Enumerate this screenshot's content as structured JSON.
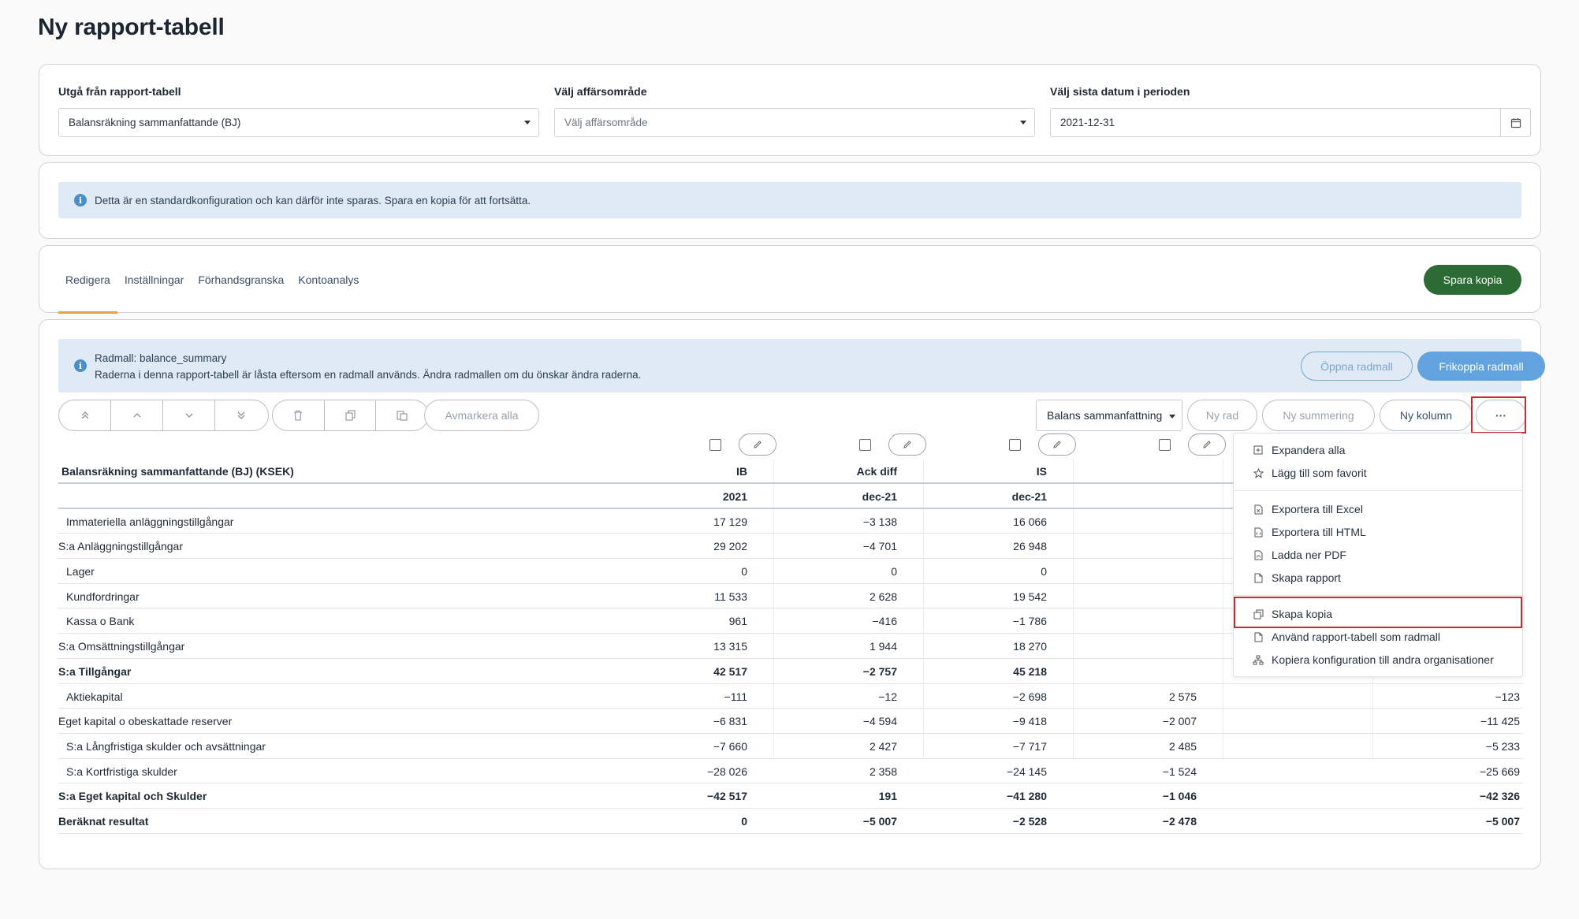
{
  "page": {
    "title": "Ny rapport-tabell"
  },
  "filters": {
    "report": {
      "label": "Utgå från rapport-tabell",
      "value": "Balansräkning sammanfattande (BJ)"
    },
    "area": {
      "label": "Välj affärsområde",
      "placeholder": "Välj affärsområde"
    },
    "date": {
      "label": "Välj sista datum i perioden",
      "value": "2021-12-31"
    }
  },
  "info": {
    "text": "Detta är en standardkonfiguration och kan därför inte sparas. Spara en kopia för att fortsätta."
  },
  "tabs": {
    "items": [
      {
        "label": "Redigera",
        "active": true
      },
      {
        "label": "Inställningar",
        "active": false
      },
      {
        "label": "Förhandsgranska",
        "active": false
      },
      {
        "label": "Kontoanalys",
        "active": false
      }
    ],
    "save_label": "Spara kopia"
  },
  "radmall": {
    "line1": "Radmall: balance_summary",
    "line2": "Raderna i denna rapport-tabell är låsta eftersom en radmall används. Ändra radmallen om du önskar ändra raderna.",
    "open_label": "Öppna radmall",
    "detach_label": "Frikoppla radmall"
  },
  "toolbar": {
    "deselect_label": "Avmarkera alla",
    "view_select": "Balans sammanfattning",
    "new_row": "Ny rad",
    "new_sum": "Ny summering",
    "new_col": "Ny kolumn",
    "more": "···"
  },
  "table": {
    "title": "Balansräkning sammanfattande (BJ) (KSEK)",
    "columns": [
      {
        "header": "IB",
        "sub": "2021"
      },
      {
        "header": "Ack diff",
        "sub": "dec-21"
      },
      {
        "header": "IS",
        "sub": "dec-21"
      }
    ],
    "rows": [
      {
        "label": "Immateriella anläggningstillgångar",
        "vals": [
          "17 129",
          "−3 138",
          "16 066",
          "",
          ""
        ]
      },
      {
        "label": "S:a Anläggningstillgångar",
        "vals": [
          "29 202",
          "−4 701",
          "26 948",
          "",
          ""
        ]
      },
      {
        "label": "Lager",
        "vals": [
          "0",
          "0",
          "0",
          "",
          ""
        ]
      },
      {
        "label": "Kundfordringar",
        "vals": [
          "11 533",
          "2 628",
          "19 542",
          "",
          ""
        ]
      },
      {
        "label": "Kassa o Bank",
        "vals": [
          "961",
          "−416",
          "−1 786",
          "",
          ""
        ]
      },
      {
        "label": "S:a Omsättningstillgångar",
        "vals": [
          "13 315",
          "1 944",
          "18 270",
          "",
          ""
        ]
      },
      {
        "label": "S:a Tillgångar",
        "vals": [
          "42 517",
          "−2 757",
          "45 218",
          "",
          ""
        ]
      },
      {
        "label": "Aktiekapital",
        "vals": [
          "−111",
          "−12",
          "−2 698",
          "2 575",
          "−123"
        ]
      },
      {
        "label": "Eget kapital o obeskattade reserver",
        "vals": [
          "−6 831",
          "−4 594",
          "−9 418",
          "−2 007",
          "−11 425"
        ]
      },
      {
        "label": "S:a Långfristiga skulder och avsättningar",
        "vals": [
          "−7 660",
          "2 427",
          "−7 717",
          "2 485",
          "−5 233"
        ]
      },
      {
        "label": "S:a Kortfristiga skulder",
        "vals": [
          "−28 026",
          "2 358",
          "−24 145",
          "−1 524",
          "−25 669"
        ]
      },
      {
        "label": "S:a Eget kapital och Skulder",
        "vals": [
          "−42 517",
          "191",
          "−41 280",
          "−1 046",
          "−42 326"
        ]
      },
      {
        "label": "Beräknat resultat",
        "vals": [
          "0",
          "−5 007",
          "−2 528",
          "−2 478",
          "−5 007"
        ]
      }
    ]
  },
  "menu": {
    "items": [
      {
        "label": "Expandera alla",
        "icon": "expand-icon"
      },
      {
        "label": "Lägg till som favorit",
        "icon": "star-icon"
      },
      {
        "label": "Exportera till Excel",
        "icon": "excel-file-icon"
      },
      {
        "label": "Exportera till HTML",
        "icon": "html-file-icon"
      },
      {
        "label": "Ladda ner PDF",
        "icon": "pdf-file-icon"
      },
      {
        "label": "Skapa rapport",
        "icon": "file-icon"
      },
      {
        "label": "Skapa kopia",
        "icon": "copy-icon"
      },
      {
        "label": "Använd rapport-tabell som radmall",
        "icon": "file-icon"
      },
      {
        "label": "Kopiera konfiguration till andra organisationer",
        "icon": "sitemap-icon"
      }
    ]
  },
  "colors": {
    "save": "#2c6b33",
    "accent_tab": "#e3a44a",
    "info_bg": "#dfeaf5",
    "detach": "#62a2de",
    "highlight": "#d0262e"
  }
}
